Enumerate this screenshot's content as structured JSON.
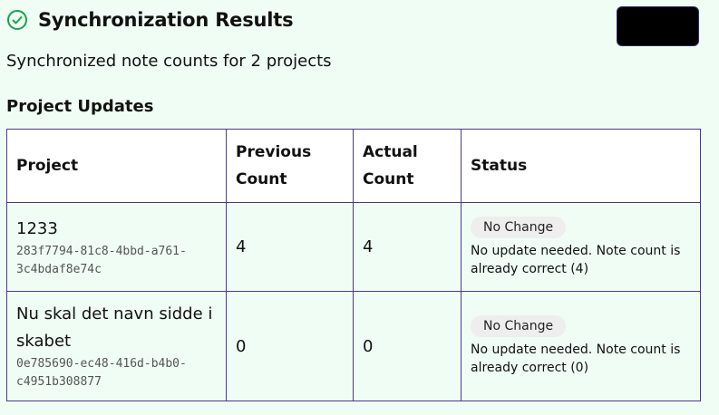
{
  "header": {
    "title": "Synchronization Results",
    "icon": "check-circle-icon",
    "accent_color": "#16a34a"
  },
  "summary": "Synchronized note counts for 2 projects",
  "section_title": "Project Updates",
  "table": {
    "columns": [
      "Project",
      "Previous Count",
      "Actual Count",
      "Status"
    ],
    "rows": [
      {
        "name": "1233",
        "id": "283f7794-81c8-4bbd-a761-3c4bdaf8e74c",
        "previous": "4",
        "actual": "4",
        "status": "No Change",
        "message": "No update needed. Note count is already correct (4)"
      },
      {
        "name": "Nu skal det navn sidde i skabet",
        "id": "0e785690-ec48-416d-b4b0-c4951b308877",
        "previous": "0",
        "actual": "0",
        "status": "No Change",
        "message": "No update needed. Note count is already correct (0)"
      }
    ]
  }
}
